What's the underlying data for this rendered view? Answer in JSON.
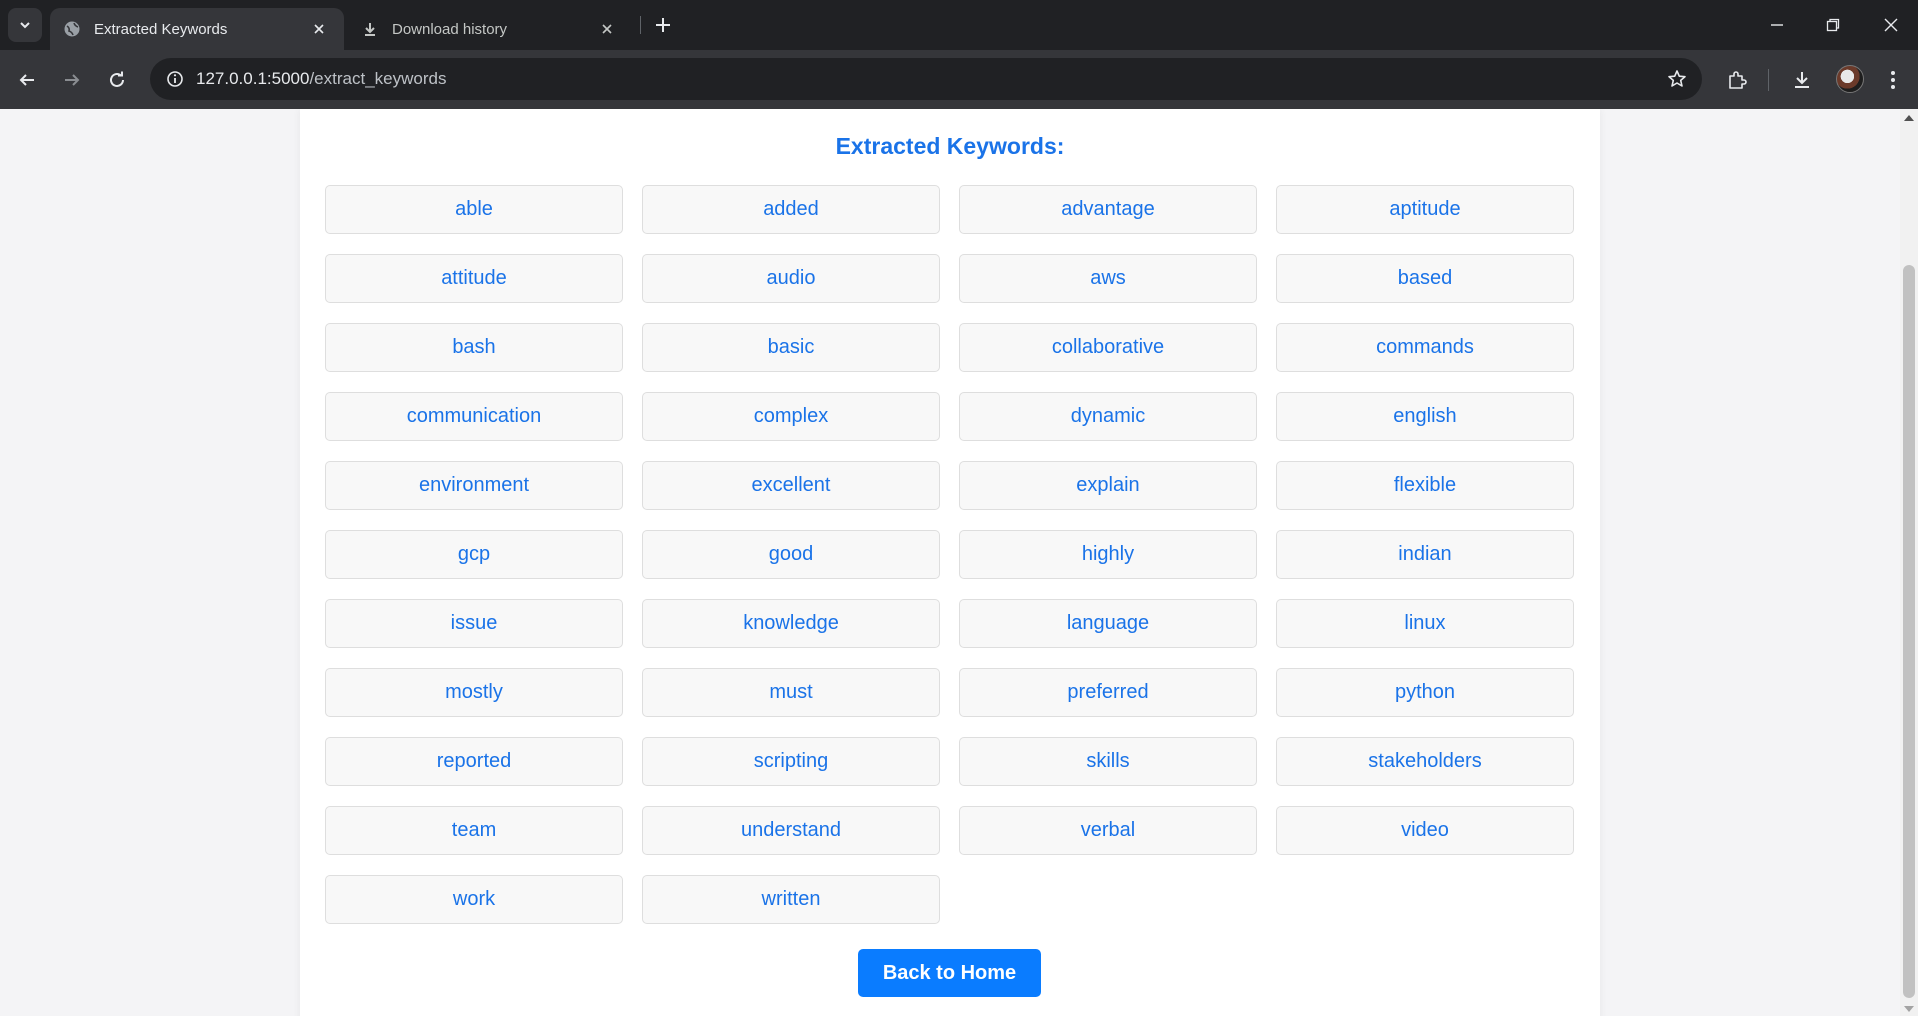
{
  "browser": {
    "tabs": [
      {
        "title": "Extracted Keywords",
        "icon": "globe-icon",
        "active": true
      },
      {
        "title": "Download history",
        "icon": "download-icon",
        "active": false
      }
    ],
    "url_host": "127.0.0.1:5000",
    "url_path": "/extract_keywords"
  },
  "page": {
    "heading": "Extracted Keywords:",
    "keywords": [
      "able",
      "added",
      "advantage",
      "aptitude",
      "attitude",
      "audio",
      "aws",
      "based",
      "bash",
      "basic",
      "collaborative",
      "commands",
      "communication",
      "complex",
      "dynamic",
      "english",
      "environment",
      "excellent",
      "explain",
      "flexible",
      "gcp",
      "good",
      "highly",
      "indian",
      "issue",
      "knowledge",
      "language",
      "linux",
      "mostly",
      "must",
      "preferred",
      "python",
      "reported",
      "scripting",
      "skills",
      "stakeholders",
      "team",
      "understand",
      "verbal",
      "video",
      "work",
      "written"
    ],
    "back_button_label": "Back to Home"
  },
  "colors": {
    "accent": "#1a73e8",
    "button_bg": "#0a7cff",
    "chrome_dark": "#202124",
    "chrome_toolbar": "#35363a"
  }
}
